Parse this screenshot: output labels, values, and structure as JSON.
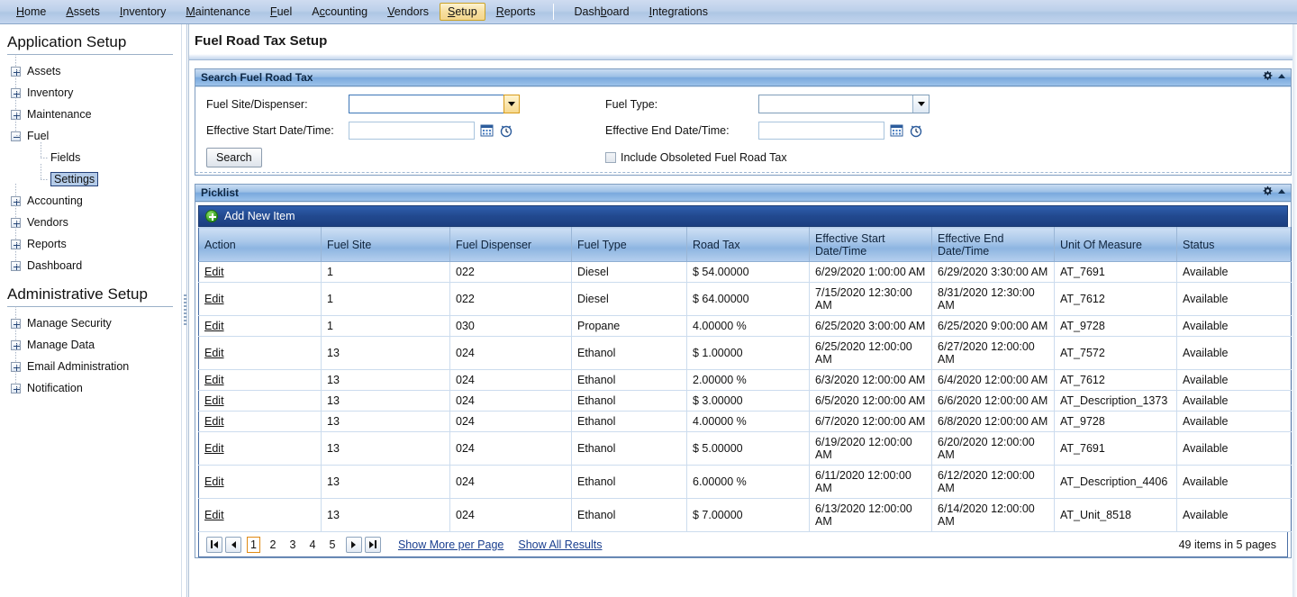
{
  "topnav": {
    "items": [
      {
        "label": "Home",
        "accel": "H",
        "selected": false
      },
      {
        "label": "Assets",
        "accel": "A",
        "selected": false
      },
      {
        "label": "Inventory",
        "accel": "I",
        "selected": false
      },
      {
        "label": "Maintenance",
        "accel": "M",
        "selected": false
      },
      {
        "label": "Fuel",
        "accel": "F",
        "selected": false
      },
      {
        "label": "Accounting",
        "accel": "c",
        "selected": false
      },
      {
        "label": "Vendors",
        "accel": "V",
        "selected": false
      },
      {
        "label": "Setup",
        "accel": "S",
        "selected": true
      },
      {
        "label": "Reports",
        "accel": "R",
        "selected": false
      }
    ],
    "items_right": [
      {
        "label": "Dashboard",
        "accel": "b",
        "selected": false
      },
      {
        "label": "Integrations",
        "accel": "I",
        "selected": false
      }
    ]
  },
  "sidebar": {
    "app_setup_title": "Application Setup",
    "admin_setup_title": "Administrative Setup",
    "app_items": [
      {
        "label": "Assets",
        "expanded": false
      },
      {
        "label": "Inventory",
        "expanded": false
      },
      {
        "label": "Maintenance",
        "expanded": false
      },
      {
        "label": "Fuel",
        "expanded": true
      },
      {
        "label": "Accounting",
        "expanded": false
      },
      {
        "label": "Vendors",
        "expanded": false
      },
      {
        "label": "Reports",
        "expanded": false
      },
      {
        "label": "Dashboard",
        "expanded": false
      }
    ],
    "fuel_children": [
      {
        "label": "Fields",
        "selected": false
      },
      {
        "label": "Settings",
        "selected": true
      }
    ],
    "admin_items": [
      {
        "label": "Manage Security",
        "expanded": false
      },
      {
        "label": "Manage Data",
        "expanded": false
      },
      {
        "label": "Email Administration",
        "expanded": false
      },
      {
        "label": "Notification",
        "expanded": false
      }
    ]
  },
  "page": {
    "title": "Fuel Road Tax Setup"
  },
  "search_panel": {
    "title": "Search Fuel Road Tax",
    "fuel_site_label": "Fuel Site/Dispenser:",
    "fuel_site_value": "",
    "fuel_site_placeholder": "",
    "fuel_type_label": "Fuel Type:",
    "fuel_type_value": "",
    "fuel_type_placeholder": "",
    "start_date_label": "Effective Start Date/Time:",
    "start_date_value": "",
    "start_date_placeholder": "",
    "end_date_label": "Effective End Date/Time:",
    "end_date_value": "",
    "end_date_placeholder": "",
    "search_button": "Search",
    "include_obsoleted_label": "Include Obsoleted Fuel Road Tax",
    "include_obsoleted_checked": false,
    "gear_icon": "gear-icon",
    "collapse_icon": "collapse-triangle-icon"
  },
  "picklist_panel": {
    "title": "Picklist",
    "add_new_item": "Add New Item",
    "gear_icon": "gear-icon",
    "collapse_icon": "collapse-triangle-icon",
    "columns": [
      "Action",
      "Fuel Site",
      "Fuel Dispenser",
      "Fuel Type",
      "Road Tax",
      "Effective Start\nDate/Time",
      "Effective End\nDate/Time",
      "Unit Of Measure",
      "Status"
    ],
    "edit_label": "Edit",
    "rows": [
      {
        "action": "Edit",
        "fuel_site": "1",
        "fuel_dispenser": "022",
        "fuel_type": "Diesel",
        "road_tax": "$ 54.00000",
        "start": "6/29/2020 1:00:00 AM",
        "end": "6/29/2020 3:30:00 AM",
        "uom": "AT_7691",
        "status": "Available"
      },
      {
        "action": "Edit",
        "fuel_site": "1",
        "fuel_dispenser": "022",
        "fuel_type": "Diesel",
        "road_tax": "$ 64.00000",
        "start": "7/15/2020 12:30:00\nAM",
        "end": "8/31/2020 12:30:00\nAM",
        "uom": "AT_7612",
        "status": "Available"
      },
      {
        "action": "Edit",
        "fuel_site": "1",
        "fuel_dispenser": "030",
        "fuel_type": "Propane",
        "road_tax": "4.00000 %",
        "start": "6/25/2020 3:00:00 AM",
        "end": "6/25/2020 9:00:00 AM",
        "uom": "AT_9728",
        "status": "Available"
      },
      {
        "action": "Edit",
        "fuel_site": "13",
        "fuel_dispenser": "024",
        "fuel_type": "Ethanol",
        "road_tax": "$ 1.00000",
        "start": "6/25/2020 12:00:00\nAM",
        "end": "6/27/2020 12:00:00\nAM",
        "uom": "AT_7572",
        "status": "Available"
      },
      {
        "action": "Edit",
        "fuel_site": "13",
        "fuel_dispenser": "024",
        "fuel_type": "Ethanol",
        "road_tax": "2.00000 %",
        "start": "6/3/2020 12:00:00 AM",
        "end": "6/4/2020 12:00:00 AM",
        "uom": "AT_7612",
        "status": "Available"
      },
      {
        "action": "Edit",
        "fuel_site": "13",
        "fuel_dispenser": "024",
        "fuel_type": "Ethanol",
        "road_tax": "$ 3.00000",
        "start": "6/5/2020 12:00:00 AM",
        "end": "6/6/2020 12:00:00 AM",
        "uom": "AT_Description_1373",
        "status": "Available"
      },
      {
        "action": "Edit",
        "fuel_site": "13",
        "fuel_dispenser": "024",
        "fuel_type": "Ethanol",
        "road_tax": "4.00000 %",
        "start": "6/7/2020 12:00:00 AM",
        "end": "6/8/2020 12:00:00 AM",
        "uom": "AT_9728",
        "status": "Available"
      },
      {
        "action": "Edit",
        "fuel_site": "13",
        "fuel_dispenser": "024",
        "fuel_type": "Ethanol",
        "road_tax": "$ 5.00000",
        "start": "6/19/2020 12:00:00\nAM",
        "end": "6/20/2020 12:00:00\nAM",
        "uom": "AT_7691",
        "status": "Available"
      },
      {
        "action": "Edit",
        "fuel_site": "13",
        "fuel_dispenser": "024",
        "fuel_type": "Ethanol",
        "road_tax": "6.00000 %",
        "start": "6/11/2020 12:00:00\nAM",
        "end": "6/12/2020 12:00:00\nAM",
        "uom": "AT_Description_4406",
        "status": "Available"
      },
      {
        "action": "Edit",
        "fuel_site": "13",
        "fuel_dispenser": "024",
        "fuel_type": "Ethanol",
        "road_tax": "$ 7.00000",
        "start": "6/13/2020 12:00:00\nAM",
        "end": "6/14/2020 12:00:00\nAM",
        "uom": "AT_Unit_8518",
        "status": "Available"
      }
    ],
    "pager": {
      "first_icon": "first-page-icon",
      "prev_icon": "previous-page-icon",
      "next_icon": "next-page-icon",
      "last_icon": "last-page-icon",
      "pages": [
        "1",
        "2",
        "3",
        "4",
        "5"
      ],
      "current_page": "1",
      "show_more_per_page": "Show More per Page",
      "show_all_results": "Show All Results",
      "item_count": "49 items in 5 pages"
    }
  },
  "colors": {
    "accent_blue": "#22498f",
    "header_blue": "#8db5e1",
    "selected_tab": "#f3d68c",
    "current_page_border": "#e08a15",
    "link": "#1a3f8f"
  }
}
